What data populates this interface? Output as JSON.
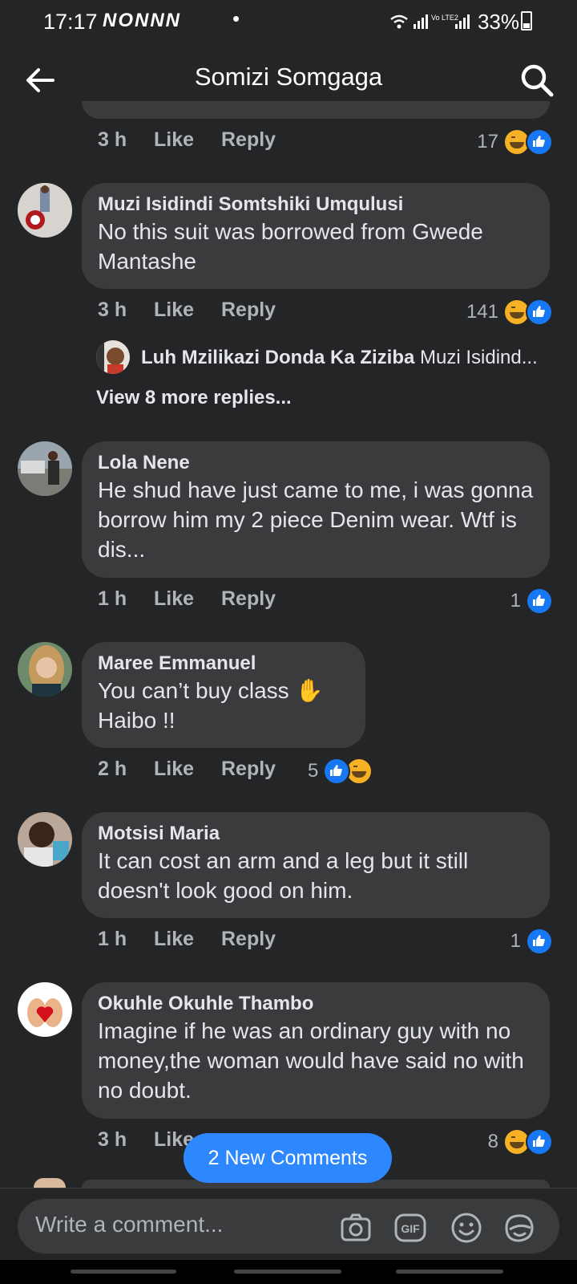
{
  "status_bar": {
    "time": "17:17",
    "app_icons": "NONNN",
    "dot": "•",
    "battery": "33%",
    "network": "Vo LTE2"
  },
  "header": {
    "title": "Somizi Somgaga"
  },
  "top_comment_meta": {
    "time": "3 h",
    "like": "Like",
    "reply": "Reply",
    "count": "17"
  },
  "comments": [
    {
      "name": "Muzi Isidindi Somtshiki Umqulusi",
      "text": "No this suit was borrowed from Gwede Mantashe",
      "time": "3 h",
      "like": "Like",
      "reply": "Reply",
      "count": "141"
    },
    {
      "name": "Lola Nene",
      "text": "He shud have just came to me, i was gonna borrow him my 2 piece Denim wear. Wtf is dis...",
      "time": "1 h",
      "like": "Like",
      "reply": "Reply",
      "count": "1"
    },
    {
      "name": "Maree Emmanuel",
      "text": "You can’t buy class ✋",
      "text2": "Haibo !!",
      "time": "2 h",
      "like": "Like",
      "reply": "Reply",
      "count": "5"
    },
    {
      "name": "Motsisi Maria",
      "text": "It can cost an arm and a leg but it still doesn't look good on him.",
      "time": "1 h",
      "like": "Like",
      "reply": "Reply",
      "count": "1"
    },
    {
      "name": "Okuhle Okuhle Thambo",
      "text": "Imagine if he was an ordinary guy with no money,the woman would have said no with no doubt.",
      "time": "3 h",
      "like": "Like",
      "count": "8"
    }
  ],
  "reply_preview": {
    "name": "Luh Mzilikazi Donda Ka Ziziba",
    "snippet": "Muzi Isidind..."
  },
  "view_more": "View 8 more replies...",
  "new_comments_button": "2 New Comments",
  "composer": {
    "placeholder": "Write a comment..."
  },
  "colors": {
    "background": "#242526",
    "bubble": "#3a3b3c",
    "accent": "#2d88ff",
    "like_blue": "#1877f2",
    "haha_yellow": "#f7b125"
  },
  "icons": [
    "back-arrow-icon",
    "search-icon",
    "camera-icon",
    "gif-icon",
    "emoji-icon",
    "sticker-icon",
    "like-reaction-icon",
    "haha-reaction-icon"
  ]
}
